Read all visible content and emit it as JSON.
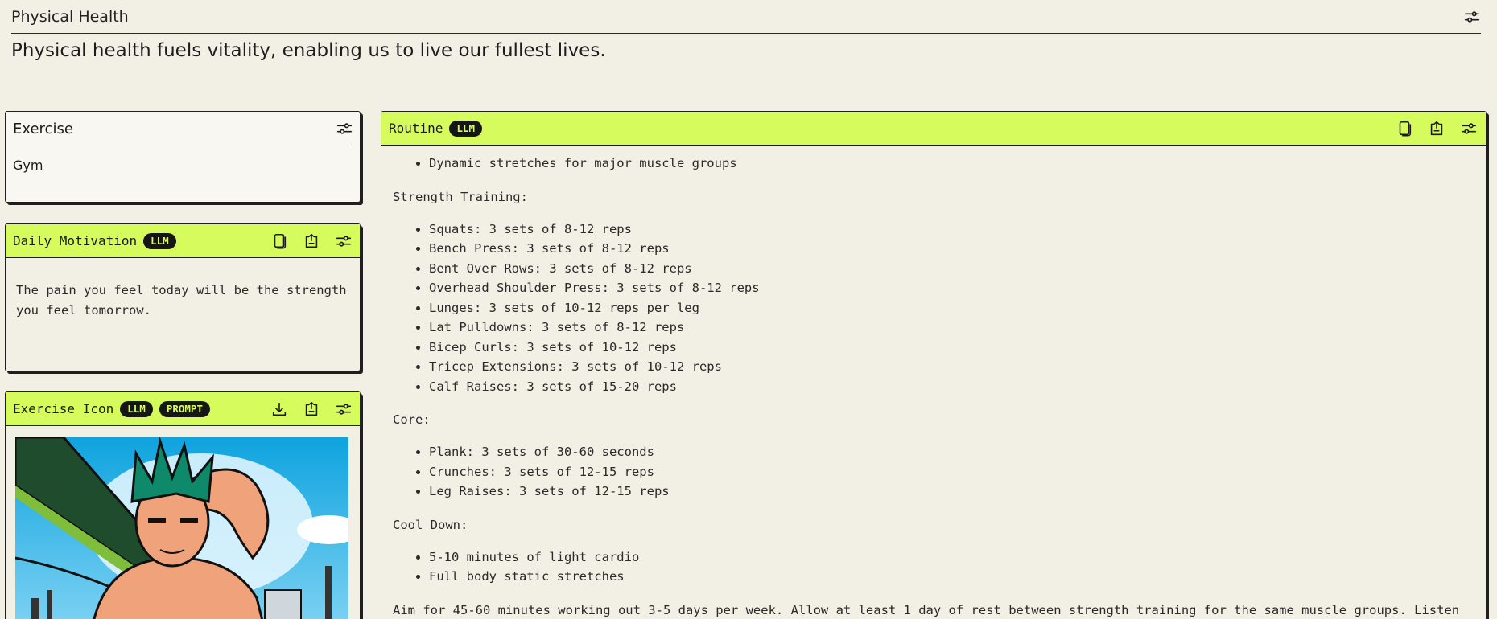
{
  "header": {
    "title": "Physical Health",
    "tagline": "Physical health fuels vitality, enabling us to live our fullest lives."
  },
  "exercise": {
    "title": "Exercise",
    "value": "Gym"
  },
  "motivation": {
    "title": "Daily Motivation",
    "badge": "LLM",
    "text": "The pain you feel today will be the strength you feel tomorrow."
  },
  "exercise_icon": {
    "title": "Exercise Icon",
    "badges": [
      "LLM",
      "PROMPT"
    ]
  },
  "routine": {
    "title": "Routine",
    "badge": "LLM",
    "warmup_items": [
      "Dynamic stretches for major muscle groups"
    ],
    "strength_title": "Strength Training:",
    "strength_items": [
      "Squats: 3 sets of 8-12 reps",
      "Bench Press: 3 sets of 8-12 reps",
      "Bent Over Rows: 3 sets of 8-12 reps",
      "Overhead Shoulder Press: 3 sets of 8-12 reps",
      "Lunges: 3 sets of 10-12 reps per leg",
      "Lat Pulldowns: 3 sets of 8-12 reps",
      "Bicep Curls: 3 sets of 10-12 reps",
      "Tricep Extensions: 3 sets of 10-12 reps",
      "Calf Raises: 3 sets of 15-20 reps"
    ],
    "core_title": "Core:",
    "core_items": [
      "Plank: 3 sets of 30-60 seconds",
      "Crunches: 3 sets of 12-15 reps",
      "Leg Raises: 3 sets of 12-15 reps"
    ],
    "cooldown_title": "Cool Down:",
    "cooldown_items": [
      "5-10 minutes of light cardio",
      "Full body static stretches"
    ],
    "closing": "Aim for 45-60 minutes working out 3-5 days per week. Allow at least 1 day of rest between strength training for the same muscle groups. Listen"
  },
  "colors": {
    "accent": "#d5fb5c",
    "background": "#f2efe4",
    "ink": "#1f1f1f"
  },
  "icons": [
    "settings-sliders-icon",
    "copy-icon",
    "export-icon",
    "download-icon"
  ]
}
